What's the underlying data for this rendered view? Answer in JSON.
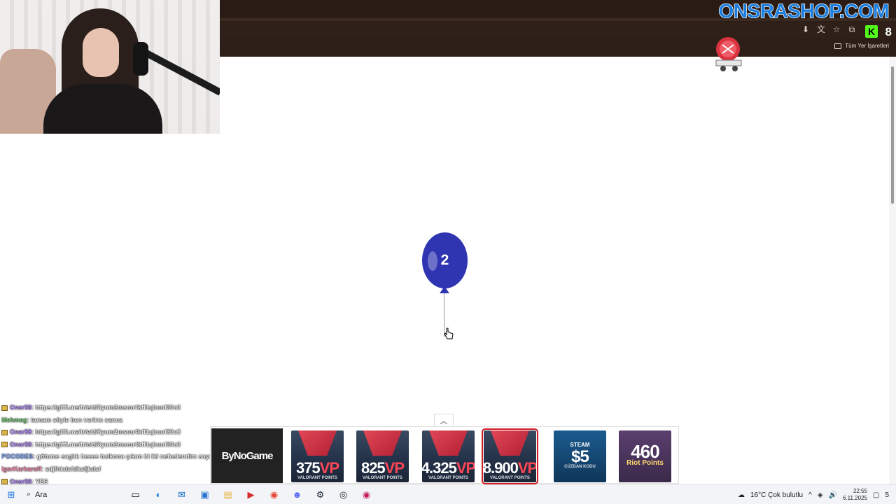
{
  "site": {
    "brand": "ONSRASHOP.COM"
  },
  "browser": {
    "bookmarks_label": "Tüm Yer İşaretleri",
    "ext_kick": "K",
    "ext_badge": "8"
  },
  "balloon": {
    "label": "2",
    "color": "#2f34b0"
  },
  "chat": [
    {
      "user": "Oner58",
      "user_color": "#b48cff",
      "text": ": https://giffi.me/tr/e/d/3yum2msou4kff1qbuof30c3",
      "badge": true
    },
    {
      "user": "Mehmeg",
      "user_color": "#7dd37d",
      "text": ": tamam söyle ben verirm sanca",
      "badge": false
    },
    {
      "user": "Oner58",
      "user_color": "#b48cff",
      "text": ": https://giffi.me/tr/e/d/3yum2msou4kff1qbuof30c3",
      "badge": true
    },
    {
      "user": "Oner58",
      "user_color": "#b48cff",
      "text": ": https://giffi.me/tr/e/d/3yum2msou4kff1qbuof30c3",
      "badge": true
    },
    {
      "user": "POCODES",
      "user_color": "#7aa7ff",
      "text": ": götume saglık heeee balkona çıkım bi iki nefeslendim sayen",
      "badge": false
    },
    {
      "user": "IgorKarkaroff",
      "user_color": "#ff8fb0",
      "text": ": sdjfhkdsfdksfjkdsf",
      "badge": false
    },
    {
      "user": "Oner58",
      "user_color": "#b48cff",
      "text": ": YES",
      "badge": true
    }
  ],
  "product_bar": {
    "logo": "ByNoGame",
    "items": [
      {
        "amount": "375",
        "unit": "VP",
        "subtitle": "VALORANT POINTS",
        "kind": "valorant",
        "selected": false
      },
      {
        "amount": "825",
        "unit": "VP",
        "subtitle": "VALORANT POINTS",
        "kind": "valorant",
        "selected": false
      },
      {
        "amount": "4.325",
        "unit": "VP",
        "subtitle": "VALORANT POINTS",
        "kind": "valorant",
        "selected": false
      },
      {
        "amount": "8.900",
        "unit": "VP",
        "subtitle": "VALORANT POINTS",
        "kind": "valorant",
        "selected": true
      },
      {
        "brand": "STEAM",
        "amount": "$5",
        "subtitle": "CÜZDAN KODU",
        "kind": "steam",
        "selected": false
      },
      {
        "amount": "460",
        "subtitle": "Riot Points",
        "kind": "lol",
        "selected": false
      }
    ]
  },
  "taskbar": {
    "search_placeholder": "Ara",
    "weather": "16°C  Çok bulutlu",
    "time": "22:55",
    "date": "6.11.2025",
    "notifications": "5"
  }
}
